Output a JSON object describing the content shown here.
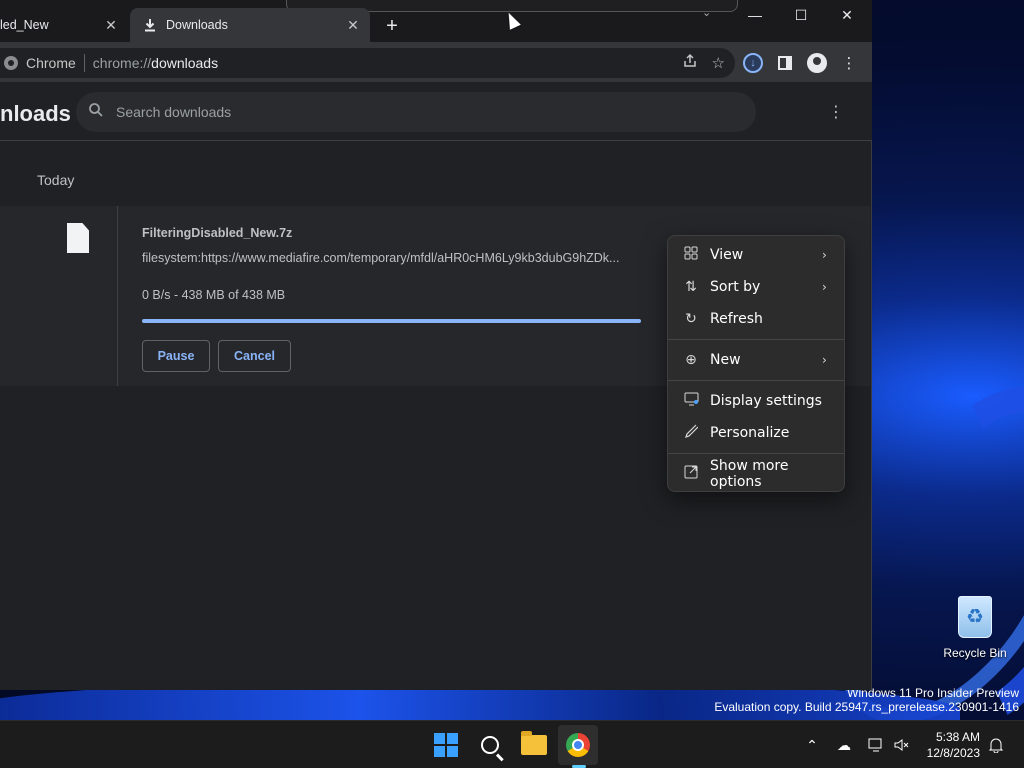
{
  "browser": {
    "tabs": [
      {
        "label": "led_New",
        "active": false
      },
      {
        "label": "Downloads",
        "active": true
      }
    ],
    "new_tab_symbol": "+",
    "window_controls": {
      "minimize": "—",
      "maximize": "☐",
      "close": "✕"
    },
    "omnibox": {
      "site_label": "Chrome",
      "url_prefix": "chrome://",
      "url_main": "downloads"
    }
  },
  "downloads_page": {
    "title": "nloads",
    "search": {
      "placeholder": "Search downloads",
      "value": ""
    },
    "date_group": "Today",
    "items": [
      {
        "file_name": "FilteringDisabled_New.7z",
        "url": "filesystem:https://www.mediafire.com/temporary/mfdl/aHR0cHM6Ly9kb3dubG9hZDk...",
        "status": "0 B/s - 438 MB of 438 MB",
        "progress_percent": 100,
        "pause_label": "Pause",
        "cancel_label": "Cancel"
      }
    ]
  },
  "context_menu": {
    "items": [
      {
        "label": "View",
        "icon": "grid-icon",
        "submenu": true
      },
      {
        "label": "Sort by",
        "icon": "sort-icon",
        "submenu": true
      },
      {
        "label": "Refresh",
        "icon": "refresh-icon",
        "submenu": false
      },
      {
        "label": "New",
        "icon": "plus-circle-icon",
        "submenu": true
      },
      {
        "label": "Display settings",
        "icon": "display-icon",
        "submenu": false
      },
      {
        "label": "Personalize",
        "icon": "brush-icon",
        "submenu": false
      },
      {
        "label": "Show more options",
        "icon": "expand-icon",
        "submenu": false
      }
    ]
  },
  "desktop": {
    "recycle_bin_label": "Recycle Bin",
    "watermark_line1": "Windows 11 Pro Insider Preview",
    "watermark_line2": "Evaluation copy. Build 25947.rs_prerelease.230901-1416"
  },
  "taskbar": {
    "time": "5:38 AM",
    "date": "12/8/2023"
  },
  "colors": {
    "accent": "#8ab4f8",
    "chrome_bg": "#202124",
    "taskbar_accent": "#60cdff"
  }
}
